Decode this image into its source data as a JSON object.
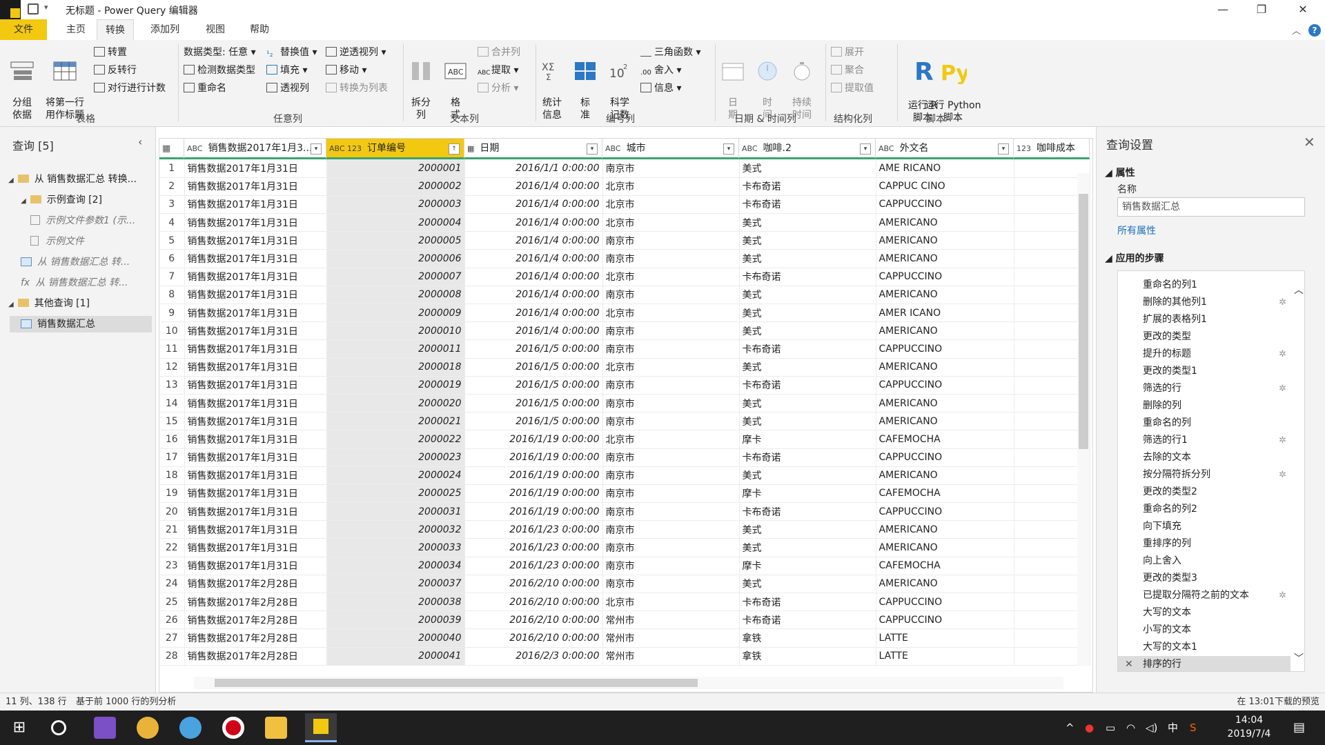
{
  "window": {
    "title": "无标题 - Power Query 编辑器",
    "help": "?"
  },
  "tabs": [
    "文件",
    "主页",
    "转换",
    "添加列",
    "视图",
    "帮助"
  ],
  "ribbon": {
    "table": {
      "group_by": "分组\n依据",
      "first_row": "将第一行\n用作标题",
      "transpose": "转置",
      "reverse": "反转行",
      "count_rows": "对行进行计数",
      "label": "表格"
    },
    "any_col": {
      "data_type": "数据类型: 任意",
      "detect_type": "检测数据类型",
      "rename": "重命名",
      "replace": "替换值",
      "fill": "填充",
      "pivot": "透视列",
      "unpivot": "逆透视列",
      "move": "移动",
      "to_list": "转换为列表",
      "label": "任意列"
    },
    "text_col": {
      "split": "拆分\n列",
      "format": "格\n式",
      "merge": "合并列",
      "extract": "提取",
      "parse": "分析",
      "label": "文本列"
    },
    "num_col": {
      "stats": "统计\n信息",
      "standard": "标\n准",
      "scientific": "科学\n记数",
      "trig": "三角函数",
      "round": "舍入",
      "info": "信息",
      "label": "编号列"
    },
    "datetime": {
      "date": "日\n期",
      "time": "时\n间",
      "duration": "持续\n时间",
      "label": "日期 & 时间列"
    },
    "structured": {
      "expand": "展开",
      "aggregate": "聚合",
      "extract_values": "提取值",
      "label": "结构化列"
    },
    "scripts": {
      "run_r": "运行 R\n脚本",
      "run_py": "运行 Python\n脚本",
      "label": "脚本"
    }
  },
  "queries": {
    "header": "查询 [5]",
    "items": [
      {
        "label": "从 销售数据汇总 转换...",
        "kind": "folder",
        "indent": 0
      },
      {
        "label": "示例查询 [2]",
        "kind": "folder",
        "indent": 1
      },
      {
        "label": "示例文件参数1 (示...",
        "kind": "param",
        "indent": 2
      },
      {
        "label": "示例文件",
        "kind": "doc",
        "indent": 2
      },
      {
        "label": "从 销售数据汇总 转...",
        "kind": "table",
        "indent": 1
      },
      {
        "label": "从 销售数据汇总 转...",
        "kind": "fx",
        "indent": 1
      },
      {
        "label": "其他查询 [1]",
        "kind": "folder",
        "indent": 0
      },
      {
        "label": "销售数据汇总",
        "kind": "table-sel",
        "indent": 1
      }
    ]
  },
  "columns": [
    {
      "type": "ABC",
      "name": "销售数据2017年1月3..."
    },
    {
      "type": "ABC 123",
      "name": "订单编号"
    },
    {
      "type": "date",
      "name": "日期"
    },
    {
      "type": "ABC",
      "name": "城市"
    },
    {
      "type": "ABC",
      "name": "咖啡.2"
    },
    {
      "type": "ABC",
      "name": "外文名"
    },
    {
      "type": "123",
      "name": "咖啡成本"
    }
  ],
  "rows": [
    [
      "销售数据2017年1月31日",
      "2000001",
      "2016/1/1 0:00:00",
      "南京市",
      "美式",
      "AME RICANO"
    ],
    [
      "销售数据2017年1月31日",
      "2000002",
      "2016/1/4 0:00:00",
      "北京市",
      "卡布奇诺",
      "CAPPUC CINO"
    ],
    [
      "销售数据2017年1月31日",
      "2000003",
      "2016/1/4 0:00:00",
      "北京市",
      "卡布奇诺",
      "CAPPUCCINO"
    ],
    [
      "销售数据2017年1月31日",
      "2000004",
      "2016/1/4 0:00:00",
      "北京市",
      "美式",
      "AMERICANO"
    ],
    [
      "销售数据2017年1月31日",
      "2000005",
      "2016/1/4 0:00:00",
      "南京市",
      "美式",
      "AMERICANO"
    ],
    [
      "销售数据2017年1月31日",
      "2000006",
      "2016/1/4 0:00:00",
      "南京市",
      "美式",
      "AMERICANO"
    ],
    [
      "销售数据2017年1月31日",
      "2000007",
      "2016/1/4 0:00:00",
      "北京市",
      "卡布奇诺",
      "CAPPUCCINO"
    ],
    [
      "销售数据2017年1月31日",
      "2000008",
      "2016/1/4 0:00:00",
      "南京市",
      "美式",
      "AMERICANO"
    ],
    [
      "销售数据2017年1月31日",
      "2000009",
      "2016/1/4 0:00:00",
      "北京市",
      "美式",
      "AMER ICANO"
    ],
    [
      "销售数据2017年1月31日",
      "2000010",
      "2016/1/4 0:00:00",
      "南京市",
      "美式",
      "AMERICANO"
    ],
    [
      "销售数据2017年1月31日",
      "2000011",
      "2016/1/5 0:00:00",
      "南京市",
      "卡布奇诺",
      "CAPPUCCINO"
    ],
    [
      "销售数据2017年1月31日",
      "2000018",
      "2016/1/5 0:00:00",
      "北京市",
      "美式",
      "AMERICANO"
    ],
    [
      "销售数据2017年1月31日",
      "2000019",
      "2016/1/5 0:00:00",
      "南京市",
      "卡布奇诺",
      "CAPPUCCINO"
    ],
    [
      "销售数据2017年1月31日",
      "2000020",
      "2016/1/5 0:00:00",
      "南京市",
      "美式",
      "AMERICANO"
    ],
    [
      "销售数据2017年1月31日",
      "2000021",
      "2016/1/5 0:00:00",
      "南京市",
      "美式",
      "AMERICANO"
    ],
    [
      "销售数据2017年1月31日",
      "2000022",
      "2016/1/19 0:00:00",
      "北京市",
      "摩卡",
      "CAFEMOCHA"
    ],
    [
      "销售数据2017年1月31日",
      "2000023",
      "2016/1/19 0:00:00",
      "南京市",
      "卡布奇诺",
      "CAPPUCCINO"
    ],
    [
      "销售数据2017年1月31日",
      "2000024",
      "2016/1/19 0:00:00",
      "南京市",
      "美式",
      "AMERICANO"
    ],
    [
      "销售数据2017年1月31日",
      "2000025",
      "2016/1/19 0:00:00",
      "南京市",
      "摩卡",
      "CAFEMOCHA"
    ],
    [
      "销售数据2017年1月31日",
      "2000031",
      "2016/1/19 0:00:00",
      "南京市",
      "卡布奇诺",
      "CAPPUCCINO"
    ],
    [
      "销售数据2017年1月31日",
      "2000032",
      "2016/1/23 0:00:00",
      "南京市",
      "美式",
      "AMERICANO"
    ],
    [
      "销售数据2017年1月31日",
      "2000033",
      "2016/1/23 0:00:00",
      "南京市",
      "美式",
      "AMERICANO"
    ],
    [
      "销售数据2017年1月31日",
      "2000034",
      "2016/1/23 0:00:00",
      "南京市",
      "摩卡",
      "CAFEMOCHA"
    ],
    [
      "销售数据2017年2月28日",
      "2000037",
      "2016/2/10 0:00:00",
      "南京市",
      "美式",
      "AMERICANO"
    ],
    [
      "销售数据2017年2月28日",
      "2000038",
      "2016/2/10 0:00:00",
      "北京市",
      "卡布奇诺",
      "CAPPUCCINO"
    ],
    [
      "销售数据2017年2月28日",
      "2000039",
      "2016/2/10 0:00:00",
      "常州市",
      "卡布奇诺",
      "CAPPUCCINO"
    ],
    [
      "销售数据2017年2月28日",
      "2000040",
      "2016/2/10 0:00:00",
      "常州市",
      "拿铁",
      "LATTE"
    ],
    [
      "销售数据2017年2月28日",
      "2000041",
      "2016/2/3 0:00:00",
      "常州市",
      "拿铁",
      "LATTE"
    ]
  ],
  "settings": {
    "title": "查询设置",
    "props_label": "属性",
    "name_label": "名称",
    "name_value": "销售数据汇总",
    "all_props": "所有属性",
    "steps_label": "应用的步骤",
    "steps": [
      {
        "label": "重命名的列1",
        "gear": false
      },
      {
        "label": "删除的其他列1",
        "gear": true
      },
      {
        "label": "扩展的表格列1",
        "gear": false
      },
      {
        "label": "更改的类型",
        "gear": false
      },
      {
        "label": "提升的标题",
        "gear": true
      },
      {
        "label": "更改的类型1",
        "gear": false
      },
      {
        "label": "筛选的行",
        "gear": true
      },
      {
        "label": "删除的列",
        "gear": false
      },
      {
        "label": "重命名的列",
        "gear": false
      },
      {
        "label": "筛选的行1",
        "gear": true
      },
      {
        "label": "去除的文本",
        "gear": false
      },
      {
        "label": "按分隔符拆分列",
        "gear": true
      },
      {
        "label": "更改的类型2",
        "gear": false
      },
      {
        "label": "重命名的列2",
        "gear": false
      },
      {
        "label": "向下填充",
        "gear": false
      },
      {
        "label": "重排序的列",
        "gear": false
      },
      {
        "label": "向上舍入",
        "gear": false
      },
      {
        "label": "更改的类型3",
        "gear": false
      },
      {
        "label": "已提取分隔符之前的文本",
        "gear": true
      },
      {
        "label": "大写的文本",
        "gear": false
      },
      {
        "label": "小写的文本",
        "gear": false
      },
      {
        "label": "大写的文本1",
        "gear": false
      },
      {
        "label": "排序的行",
        "gear": false,
        "active": true
      }
    ]
  },
  "status": {
    "left": "11 列、138 行",
    "profile": "基于前 1000 行的列分析",
    "right": "在 13:01下载的预览"
  },
  "taskbar": {
    "time": "14:04",
    "date": "2019/7/4",
    "ime": "中"
  },
  "colors": {
    "accent": "#f2c811",
    "header_underline": "#3aa36f",
    "link": "#1a6fc0"
  }
}
